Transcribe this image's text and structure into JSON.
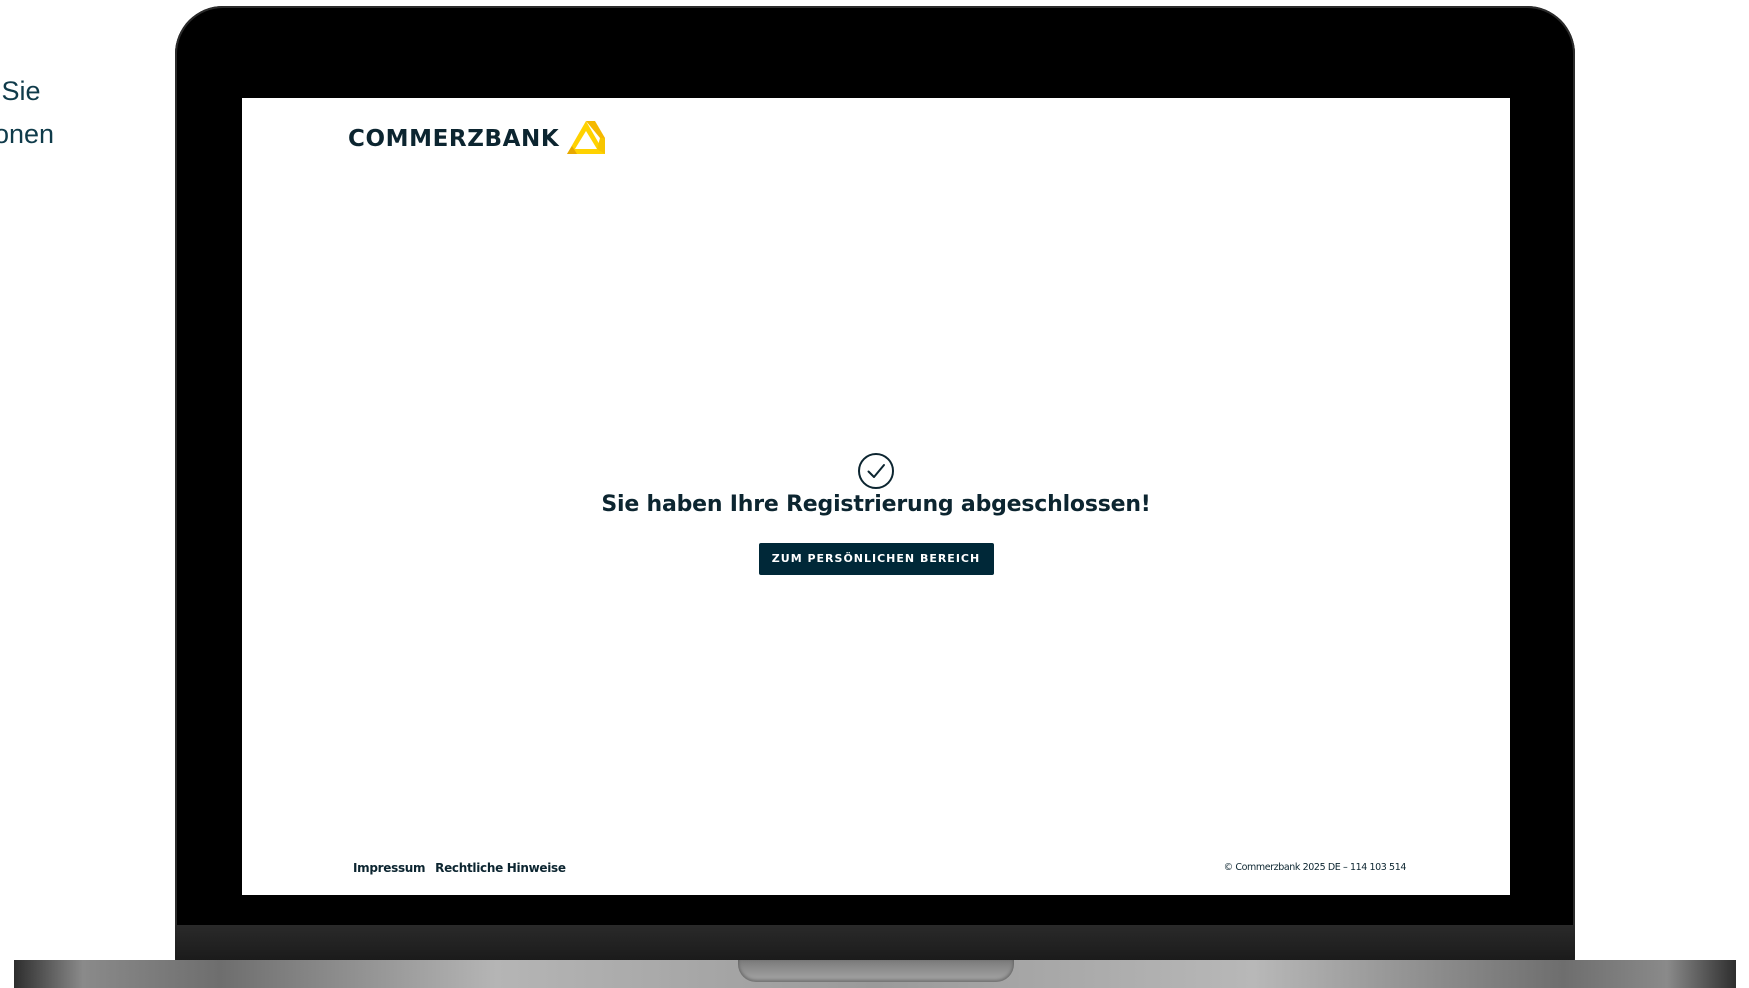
{
  "side_text": {
    "line1": "d Sie",
    "line2": "ionen"
  },
  "brand": {
    "name": "COMMERZBANK",
    "logo_icon": "commerzbank-ribbon-icon",
    "accent_color": "#ffd200",
    "dark_color": "#002838"
  },
  "main": {
    "status_icon": "check-circle-icon",
    "headline": "Sie haben Ihre Registrierung abgeschlossen!",
    "cta_label": "ZUM PERSÖNLICHEN BEREICH"
  },
  "footer": {
    "links": [
      "Impressum",
      "Rechtliche Hinweise"
    ],
    "copyright": "© Commerzbank 2025 DE – 114 103 514"
  }
}
